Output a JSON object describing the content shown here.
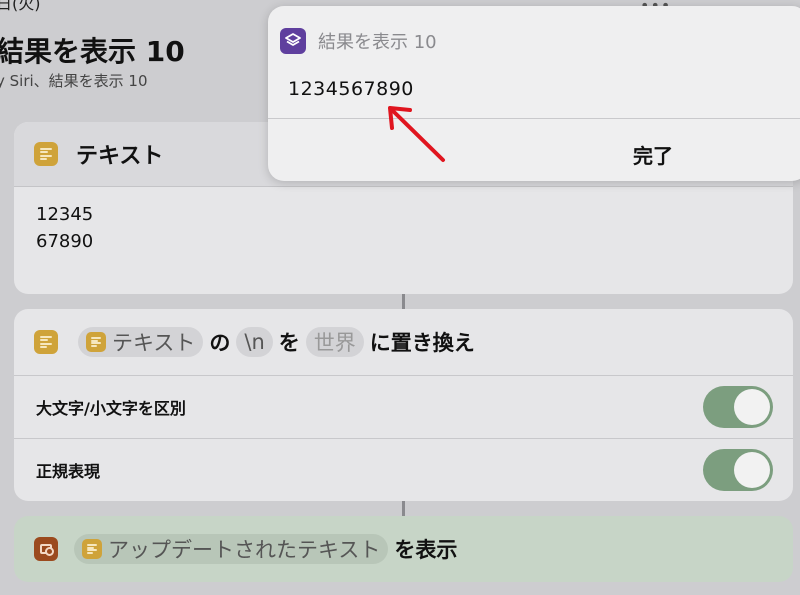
{
  "header": {
    "top_clip": "日(火)",
    "title": "結果を表示 10",
    "subtitle": "y Siri、結果を表示 10"
  },
  "text_action": {
    "title": "テキスト",
    "line1": "12345",
    "line2": "67890"
  },
  "replace_action": {
    "input_pill": "テキスト",
    "word_no": "の",
    "find_pill": "\\n",
    "word_wo": "を",
    "replace_pill": "世界",
    "action_label": "に置き換え",
    "case_label": "大文字/小文字を区別",
    "regex_label": "正規表現",
    "case_sensitive": true,
    "regex": true
  },
  "show_action": {
    "input_pill": "アップデートされたテキスト",
    "action_label": "を表示"
  },
  "popup": {
    "title": "結果を表示 10",
    "value": "1234567890",
    "done_label": "完了"
  },
  "colors": {
    "text_icon": "#cfa33a",
    "shortcuts_icon": "#5f3f9e",
    "show_icon": "#9b4a1e",
    "toggle_on": "#7c9e7f",
    "arrow": "#e0151f"
  }
}
